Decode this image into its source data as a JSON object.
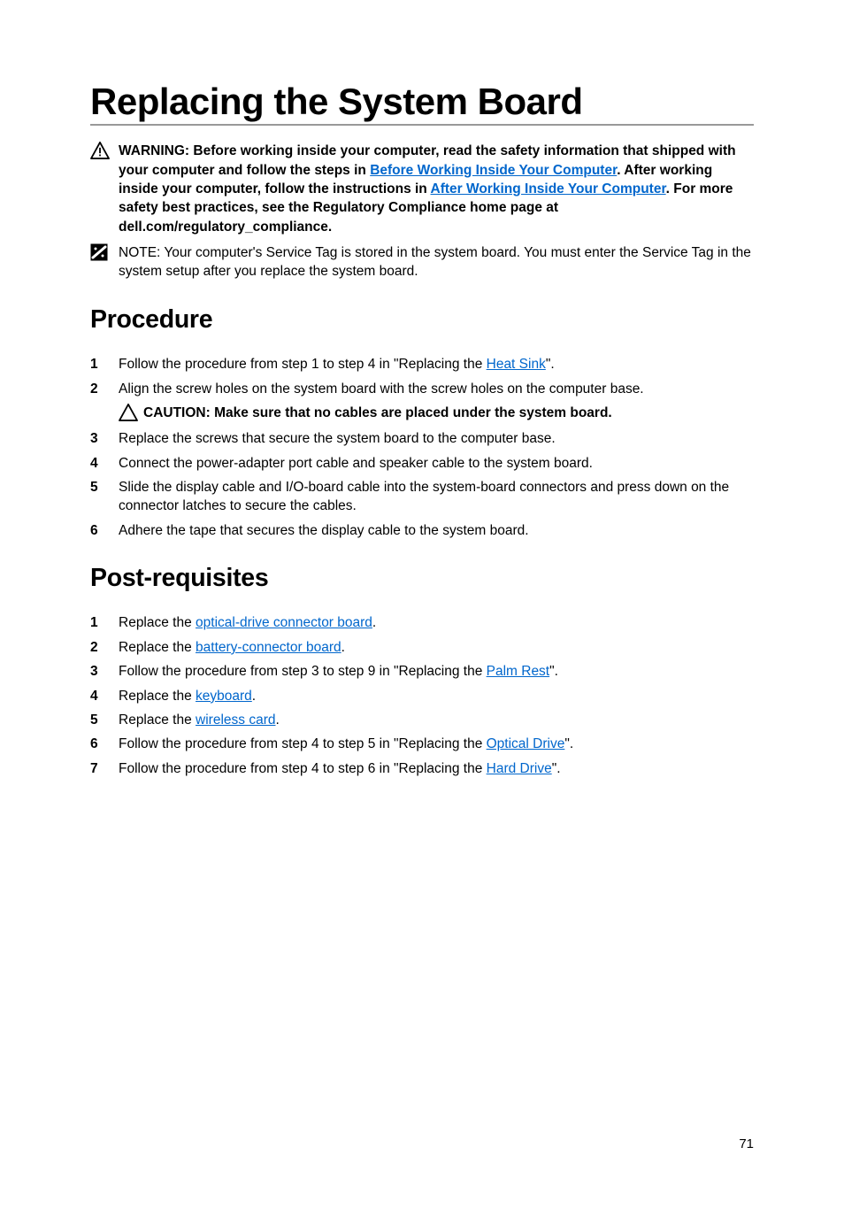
{
  "title": "Replacing the System Board",
  "warning": {
    "prefix": "WARNING: Before working inside your computer, read the safety information that shipped with your computer and follow the steps in ",
    "link1": "Before Working Inside Your Computer",
    "mid1": ". After working inside your computer, follow the instructions in ",
    "link2": "After Working Inside Your Computer",
    "suffix": ". For more safety best practices, see the Regulatory Compliance home page at dell.com/regulatory_compliance."
  },
  "note": {
    "prefix": "NOTE: ",
    "text": "Your computer's Service Tag is stored in the system board. You must enter the Service Tag in the system setup after you replace the system board."
  },
  "sections": {
    "procedure_title": "Procedure",
    "post_title": "Post-requisites"
  },
  "procedure": {
    "s1_a": "Follow the procedure from step 1 to step 4 in \"Replacing the ",
    "s1_link": "Heat Sink",
    "s1_b": "\".",
    "s2": "Align the screw holes on the system board with the screw holes on the computer base.",
    "caution": "CAUTION: Make sure that no cables are placed under the system board.",
    "s3": "Replace the screws that secure the system board to the computer base.",
    "s4": "Connect the power-adapter port cable and speaker cable to the system board.",
    "s5": "Slide the display cable and I/O-board cable into the system-board connectors and press down on the connector latches to secure the cables.",
    "s6": "Adhere the tape that secures the display cable to the system board."
  },
  "post": {
    "p1_a": "Replace the ",
    "p1_link": "optical-drive connector board",
    "p1_b": ".",
    "p2_a": "Replace the ",
    "p2_link": "battery-connector board",
    "p2_b": ".",
    "p3_a": "Follow the procedure from step 3 to step 9 in \"Replacing the ",
    "p3_link": "Palm Rest",
    "p3_b": "\".",
    "p4_a": "Replace the ",
    "p4_link": "keyboard",
    "p4_b": ".",
    "p5_a": "Replace the ",
    "p5_link": "wireless card",
    "p5_b": ".",
    "p6_a": "Follow the procedure from step 4 to step 5 in \"Replacing the ",
    "p6_link": "Optical Drive",
    "p6_b": "\".",
    "p7_a": "Follow the procedure from step 4 to step 6 in \"Replacing the ",
    "p7_link": "Hard Drive",
    "p7_b": "\"."
  },
  "page_number": "71"
}
